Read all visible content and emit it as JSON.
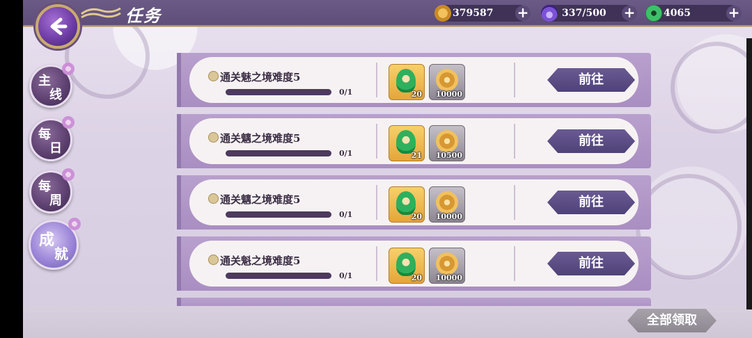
{
  "header": {
    "title": "任务",
    "resources": [
      {
        "icon": "coin-icon",
        "value": "379587"
      },
      {
        "icon": "stamina-icon",
        "value": "337/500"
      },
      {
        "icon": "jade-icon",
        "value": "4065"
      }
    ],
    "plus_label": "+"
  },
  "tabs": [
    {
      "c1": "主",
      "c2": "线",
      "active": false
    },
    {
      "c1": "每",
      "c2": "日",
      "active": false
    },
    {
      "c1": "每",
      "c2": "周",
      "active": false
    },
    {
      "c1": "成",
      "c2": "就",
      "active": true
    }
  ],
  "tasks": [
    {
      "name": "通关魅之境难度5",
      "progress": "0/1",
      "progress_fraction": 0,
      "rewards": [
        {
          "type": "jade",
          "qty": "20"
        },
        {
          "type": "coin",
          "qty": "10000"
        }
      ],
      "button": "前往"
    },
    {
      "name": "通关魑之境难度5",
      "progress": "0/1",
      "progress_fraction": 0,
      "rewards": [
        {
          "type": "jade",
          "qty": "21"
        },
        {
          "type": "coin",
          "qty": "10500"
        }
      ],
      "button": "前往"
    },
    {
      "name": "通关魑之境难度5",
      "progress": "0/1",
      "progress_fraction": 0,
      "rewards": [
        {
          "type": "jade",
          "qty": "20"
        },
        {
          "type": "coin",
          "qty": "10000"
        }
      ],
      "button": "前往"
    },
    {
      "name": "通关魁之境难度5",
      "progress": "0/1",
      "progress_fraction": 0,
      "rewards": [
        {
          "type": "jade",
          "qty": "20"
        },
        {
          "type": "coin",
          "qty": "10000"
        }
      ],
      "button": "前往"
    }
  ],
  "footer": {
    "claim_all": "全部领取"
  },
  "colors": {
    "accent": "#5d4d78",
    "gold": "#c9ab6d",
    "button": "#4e4278"
  }
}
